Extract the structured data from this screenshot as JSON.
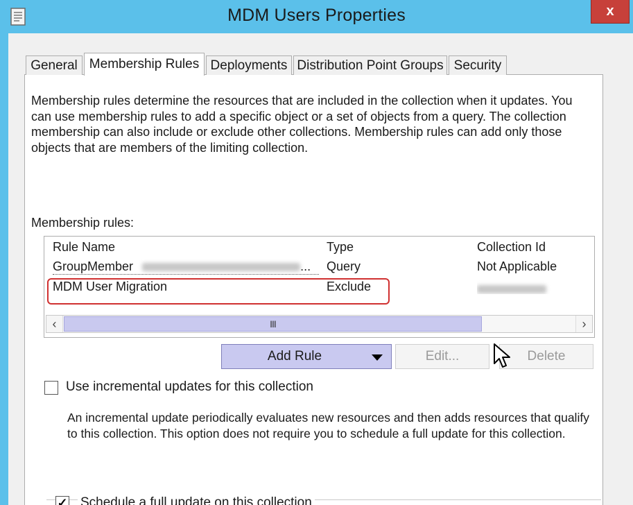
{
  "window": {
    "title": "MDM Users Properties",
    "close_label": "x"
  },
  "tabs": [
    {
      "label": "General",
      "active": false
    },
    {
      "label": "Membership Rules",
      "active": true
    },
    {
      "label": "Deployments",
      "active": false
    },
    {
      "label": "Distribution Point Groups",
      "active": false
    },
    {
      "label": "Security",
      "active": false
    }
  ],
  "description": "Membership rules determine the resources that are included in the collection when it updates. You can use membership rules to add a specific object or a set of objects from a query. The collection membership can also include or exclude other collections. Membership rules can add only those objects that are members of the limiting collection.",
  "rules_label": "Membership rules:",
  "list": {
    "columns": [
      "Rule Name",
      "Type",
      "Collection Id"
    ],
    "rows": [
      {
        "name": "GroupMember",
        "name_suffix": "...",
        "type": "Query",
        "collection_id": "Not Applicable"
      },
      {
        "name": "MDM User Migration",
        "type": "Exclude",
        "collection_id": ""
      }
    ],
    "scroll_thumb": "III"
  },
  "buttons": {
    "add_rule": "Add Rule",
    "edit": "Edit...",
    "delete": "Delete"
  },
  "incremental": {
    "checked": false,
    "label": "Use incremental updates for this collection",
    "description": "An incremental update periodically evaluates new resources and then adds resources that qualify to this collection. This option does not require you to schedule a full update for this collection."
  },
  "schedule": {
    "checked": true,
    "label": "Schedule a full update on this collection"
  },
  "colors": {
    "titlebar": "#5bc0ea",
    "close": "#c7403a",
    "highlight": "#d03030",
    "add_rule_bg": "#c9c9f0"
  }
}
